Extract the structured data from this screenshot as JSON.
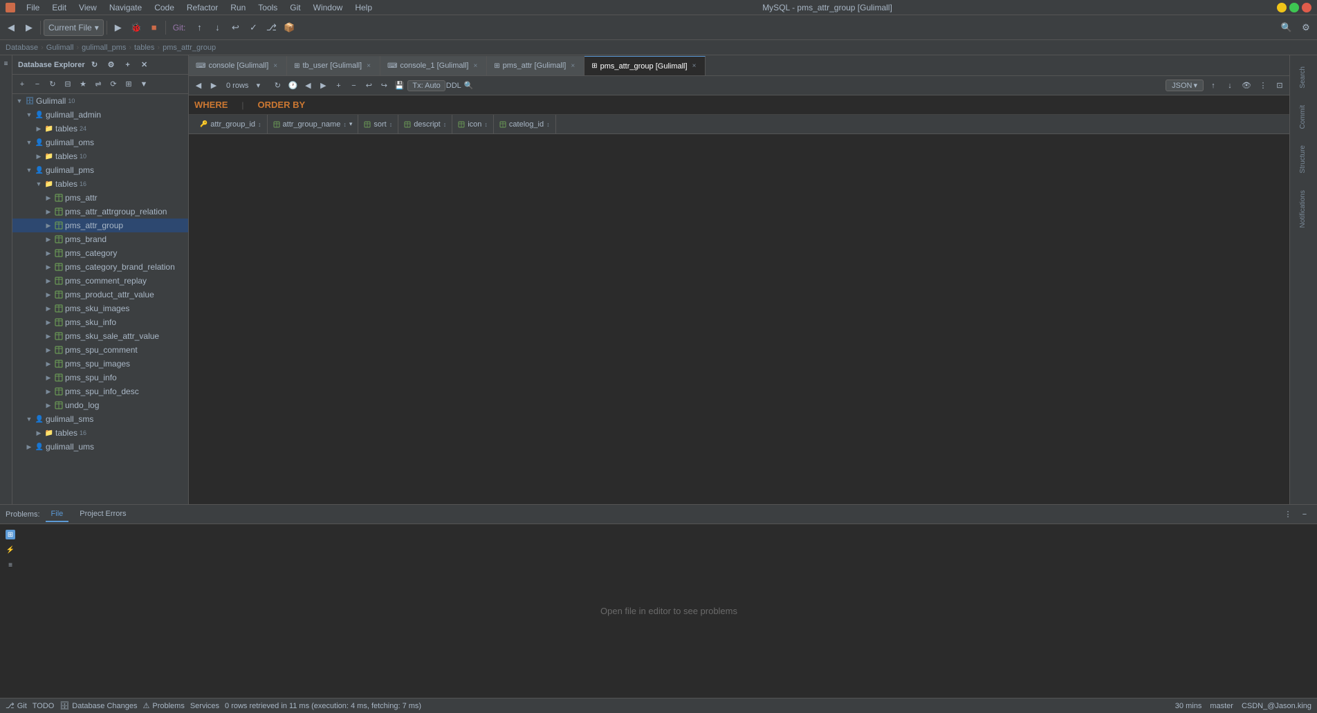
{
  "titleBar": {
    "title": "MySQL - pms_attr_group [Gulimall]",
    "menus": [
      "File",
      "Edit",
      "View",
      "Navigate",
      "Code",
      "Refactor",
      "Run",
      "Tools",
      "Git",
      "Window",
      "Help"
    ]
  },
  "toolbar": {
    "currentFile": "Current File",
    "git": "Git:",
    "runBtn": "▶",
    "stopBtn": "■"
  },
  "breadcrumb": {
    "parts": [
      "Database",
      "Gulimall",
      "gulimall_pms",
      "tables",
      "pms_attr_group"
    ]
  },
  "tabs": [
    {
      "id": "console",
      "label": "console [Gulimall]",
      "icon": "⌨",
      "active": false,
      "closable": true
    },
    {
      "id": "tb_user",
      "label": "tb_user [Gulimall]",
      "icon": "⊞",
      "active": false,
      "closable": true
    },
    {
      "id": "console_1",
      "label": "console_1 [Gulimall]",
      "icon": "⌨",
      "active": false,
      "closable": true
    },
    {
      "id": "pms_attr",
      "label": "pms_attr [Gulimall]",
      "icon": "⊞",
      "active": false,
      "closable": true
    },
    {
      "id": "pms_attr_group_active",
      "label": "pms_attr_group [Gulimall]",
      "icon": "⊞",
      "active": true,
      "closable": true
    }
  ],
  "queryToolbar": {
    "rowsLabel": "0 rows",
    "txLabel": "Tx: Auto",
    "ddlLabel": "DDL",
    "jsonLabel": "JSON"
  },
  "filterBar": {
    "whereKeyword": "WHERE",
    "orderByKeyword": "ORDER BY"
  },
  "columns": [
    {
      "name": "attr_group_id",
      "key": "🔑",
      "sort": "↕"
    },
    {
      "name": "attr_group_name",
      "key": "",
      "sort": "↕",
      "dropdown": true
    },
    {
      "name": "sort",
      "key": "",
      "sort": "↕"
    },
    {
      "name": "descript",
      "key": "",
      "sort": "↕"
    },
    {
      "name": "icon",
      "key": "",
      "sort": "↕"
    },
    {
      "name": "catelog_id",
      "key": "",
      "sort": "↕"
    }
  ],
  "dbExplorer": {
    "title": "Database Explorer",
    "tree": [
      {
        "level": 0,
        "label": "Gulimall",
        "badge": "10",
        "type": "db",
        "expanded": true,
        "arrow": "▼"
      },
      {
        "level": 1,
        "label": "gulimall_admin",
        "type": "schema",
        "expanded": true,
        "arrow": "▼"
      },
      {
        "level": 2,
        "label": "tables",
        "badge": "24",
        "type": "folder",
        "expanded": false,
        "arrow": "▶"
      },
      {
        "level": 1,
        "label": "gulimall_oms",
        "type": "schema",
        "expanded": true,
        "arrow": "▼"
      },
      {
        "level": 2,
        "label": "tables",
        "badge": "10",
        "type": "folder",
        "expanded": false,
        "arrow": "▶"
      },
      {
        "level": 1,
        "label": "gulimall_pms",
        "type": "schema",
        "expanded": true,
        "arrow": "▼"
      },
      {
        "level": 2,
        "label": "tables",
        "badge": "16",
        "type": "folder",
        "expanded": true,
        "arrow": "▼"
      },
      {
        "level": 3,
        "label": "pms_attr",
        "type": "table",
        "expanded": false,
        "arrow": "▶"
      },
      {
        "level": 3,
        "label": "pms_attr_attrgroup_relation",
        "type": "table",
        "expanded": false,
        "arrow": "▶"
      },
      {
        "level": 3,
        "label": "pms_attr_group",
        "type": "table",
        "expanded": false,
        "arrow": "▶",
        "selected": true
      },
      {
        "level": 3,
        "label": "pms_brand",
        "type": "table",
        "expanded": false,
        "arrow": "▶"
      },
      {
        "level": 3,
        "label": "pms_category",
        "type": "table",
        "expanded": false,
        "arrow": "▶"
      },
      {
        "level": 3,
        "label": "pms_category_brand_relation",
        "type": "table",
        "expanded": false,
        "arrow": "▶"
      },
      {
        "level": 3,
        "label": "pms_comment_replay",
        "type": "table",
        "expanded": false,
        "arrow": "▶"
      },
      {
        "level": 3,
        "label": "pms_product_attr_value",
        "type": "table",
        "expanded": false,
        "arrow": "▶"
      },
      {
        "level": 3,
        "label": "pms_sku_images",
        "type": "table",
        "expanded": false,
        "arrow": "▶"
      },
      {
        "level": 3,
        "label": "pms_sku_info",
        "type": "table",
        "expanded": false,
        "arrow": "▶"
      },
      {
        "level": 3,
        "label": "pms_sku_sale_attr_value",
        "type": "table",
        "expanded": false,
        "arrow": "▶"
      },
      {
        "level": 3,
        "label": "pms_spu_comment",
        "type": "table",
        "expanded": false,
        "arrow": "▶"
      },
      {
        "level": 3,
        "label": "pms_spu_images",
        "type": "table",
        "expanded": false,
        "arrow": "▶"
      },
      {
        "level": 3,
        "label": "pms_spu_info",
        "type": "table",
        "expanded": false,
        "arrow": "▶"
      },
      {
        "level": 3,
        "label": "pms_spu_info_desc",
        "type": "table",
        "expanded": false,
        "arrow": "▶"
      },
      {
        "level": 3,
        "label": "undo_log",
        "type": "table",
        "expanded": false,
        "arrow": "▶"
      },
      {
        "level": 1,
        "label": "gulimall_sms",
        "type": "schema",
        "expanded": true,
        "arrow": "▼"
      },
      {
        "level": 2,
        "label": "tables",
        "badge": "16",
        "type": "folder",
        "expanded": false,
        "arrow": "▶"
      },
      {
        "level": 1,
        "label": "gulimall_ums",
        "type": "schema",
        "expanded": false,
        "arrow": "▶"
      }
    ]
  },
  "problemsPanel": {
    "title": "Problems:",
    "tabs": [
      "File",
      "Project Errors"
    ],
    "activeTab": "File",
    "emptyMessage": "Open file in editor to see problems"
  },
  "statusBar": {
    "gitBranch": "Git",
    "todo": "TODO",
    "dbChanges": "Database Changes",
    "problems": "Problems",
    "services": "Services",
    "rowsInfo": "0 rows retrieved in 11 ms (execution: 4 ms, fetching: 7 ms)",
    "timeLabel": "30 mins",
    "userLabel": "master",
    "rightInfo": "CSDN_@Jason.king"
  },
  "rightPanelTabs": [
    "Search",
    "Commit",
    "Structure",
    "Notifications"
  ]
}
